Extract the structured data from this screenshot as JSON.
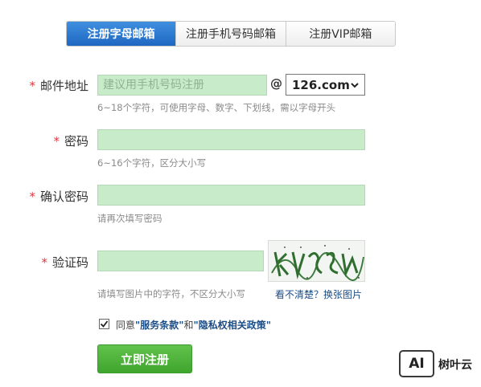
{
  "tabs": [
    {
      "label": "注册字母邮箱",
      "active": true
    },
    {
      "label": "注册手机号码邮箱",
      "active": false
    },
    {
      "label": "注册VIP邮箱",
      "active": false
    }
  ],
  "form": {
    "required_mark": "*",
    "email": {
      "label": "邮件地址",
      "placeholder": "建议用手机号码注册",
      "at": "@",
      "domain": "126.com",
      "hint": "6~18个字符，可使用字母、数字、下划线，需以字母开头"
    },
    "password": {
      "label": "密码",
      "hint": "6~16个字符，区分大小写"
    },
    "confirm": {
      "label": "确认密码",
      "hint": "请再次填写密码"
    },
    "captcha": {
      "label": "验证码",
      "hint": "请填写图片中的字符，不区分大小写",
      "refresh_link": "看不清楚？换张图片"
    },
    "agreement": {
      "checked": true,
      "prefix": "同意",
      "terms": "\"服务条款\"",
      "and": "和",
      "privacy": "\"隐私权相关政策\""
    },
    "submit_label": "立即注册"
  },
  "watermark": {
    "logo_text": "AI",
    "brand": "树叶云"
  },
  "colors": {
    "active_tab": "#2a78d2",
    "input_bg": "#c8ecc9",
    "required": "#e0383e",
    "submit": "#4cb13a",
    "link": "#1b4d86"
  }
}
